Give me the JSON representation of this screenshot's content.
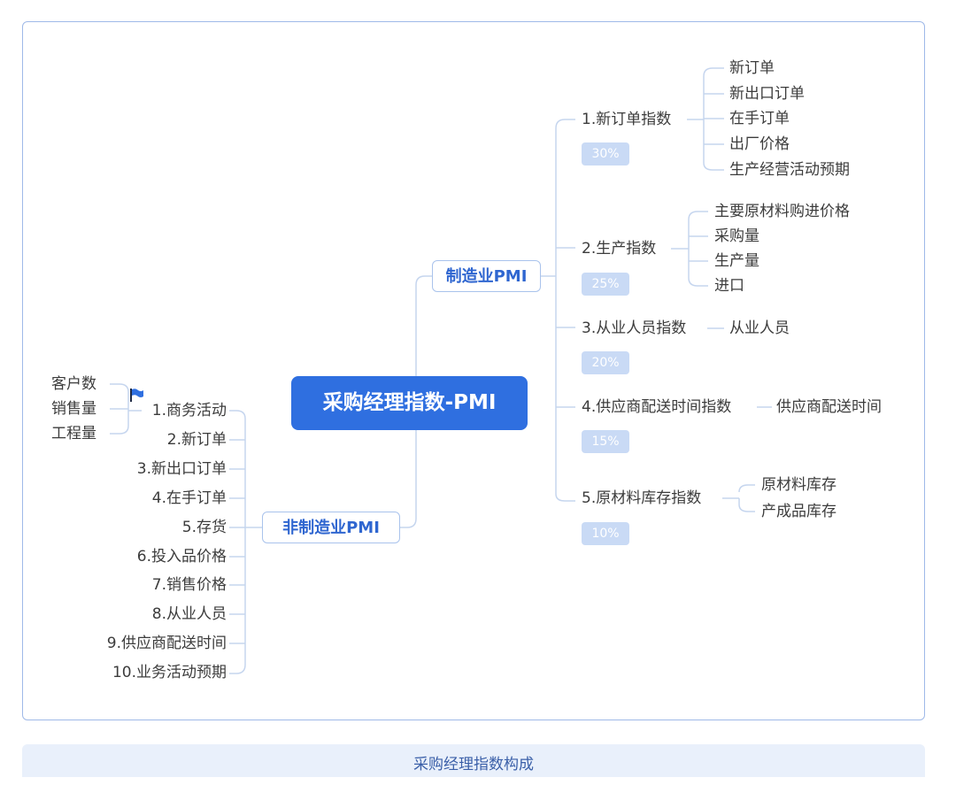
{
  "root": "采购经理指数-PMI",
  "manufacturing": {
    "label": "制造业PMI",
    "indices": [
      {
        "label": "1.新订单指数",
        "weight": "30%",
        "items": [
          "新订单",
          "新出口订单",
          "在手订单",
          "出厂价格",
          "生产经营活动预期"
        ]
      },
      {
        "label": "2.生产指数",
        "weight": "25%",
        "items": [
          "主要原材料购进价格",
          "采购量",
          "生产量",
          "进口"
        ]
      },
      {
        "label": "3.从业人员指数",
        "weight": "20%",
        "items": [
          "从业人员"
        ]
      },
      {
        "label": "4.供应商配送时间指数",
        "weight": "15%",
        "items": [
          "供应商配送时间"
        ]
      },
      {
        "label": "5.原材料库存指数",
        "weight": "10%",
        "items": [
          "原材料库存",
          "产成品库存"
        ]
      }
    ]
  },
  "non_manufacturing": {
    "label": "非制造业PMI",
    "items": [
      "1.商务活动",
      "2.新订单",
      "3.新出口订单",
      "4.在手订单",
      "5.存货",
      "6.投入品价格",
      "7.销售价格",
      "8.从业人员",
      "9.供应商配送时间",
      "10.业务活动预期"
    ],
    "business_activity_subitems": [
      "客户数",
      "销售量",
      "工程量"
    ]
  },
  "caption": "采购经理指数构成",
  "colors": {
    "root": "#2f6fe0",
    "branch_text": "#2f66d0",
    "pill": "#c9daf5",
    "line": "#c5d5ee",
    "frame": "#9fb9e8"
  }
}
